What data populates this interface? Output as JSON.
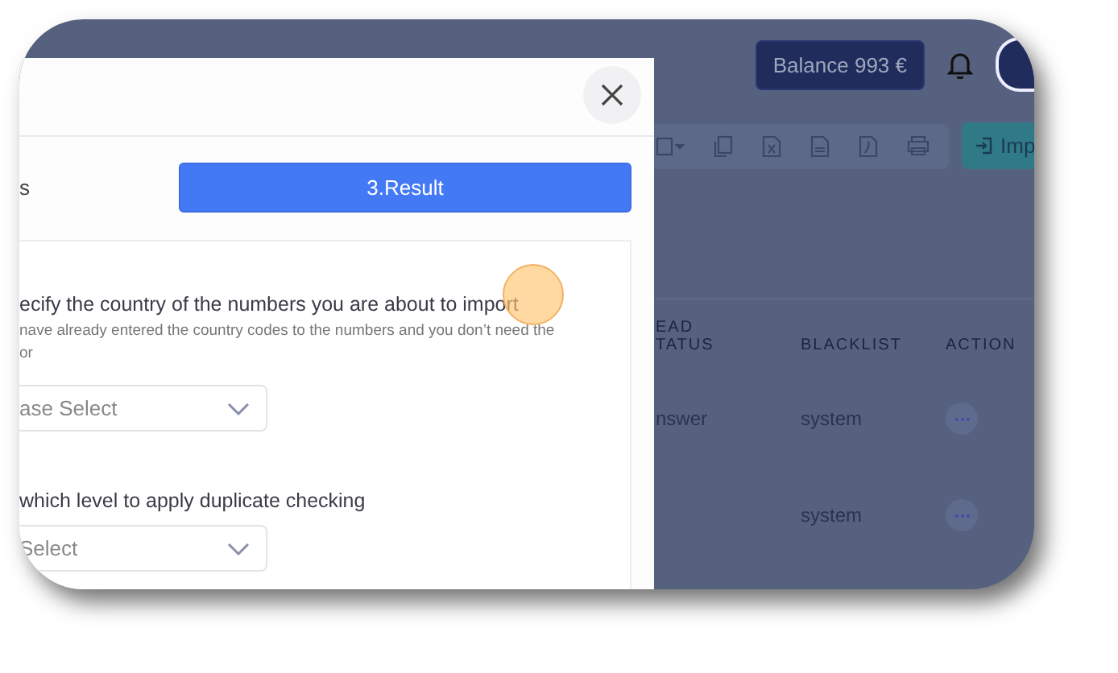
{
  "header": {
    "balance": "Balance 993 €"
  },
  "toolbar": {
    "import_button": "Imp"
  },
  "table": {
    "columns": [
      {
        "label": "EAD TATUS"
      },
      {
        "label": "BLACKLIST"
      },
      {
        "label": "ACTION"
      }
    ],
    "rows": [
      {
        "lead_status": "nswer",
        "blacklist": "system"
      },
      {
        "blacklist": "system"
      }
    ]
  },
  "modal": {
    "steps": [
      {
        "label": "s",
        "selected": false
      },
      {
        "label": "3.Result",
        "selected": true
      }
    ],
    "fields": [
      {
        "label": "ecify the country of the numbers you are about to import",
        "hint": "nave already entered the country codes to the numbers and you don’t need the or",
        "placeholder": "ase Select"
      },
      {
        "label": "which level to apply duplicate checking",
        "placeholder": "Select"
      }
    ]
  }
}
